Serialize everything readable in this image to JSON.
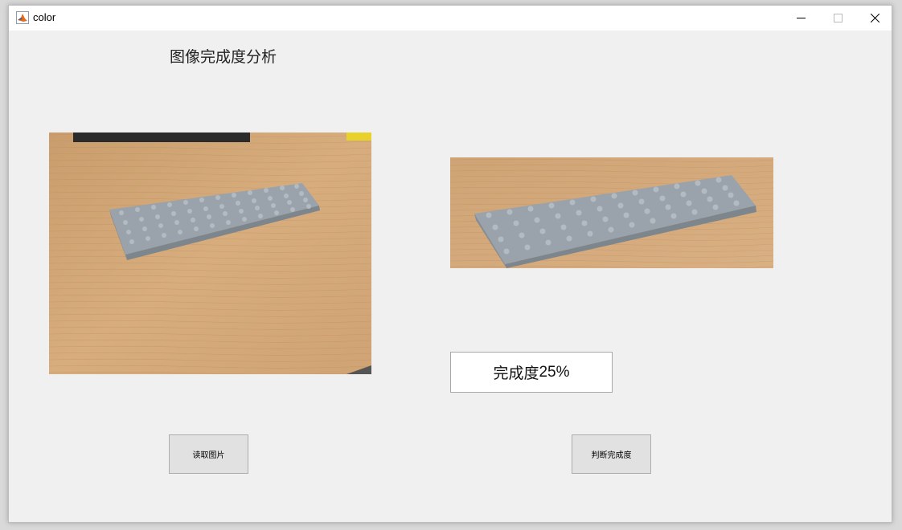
{
  "window": {
    "title": "color",
    "app_icon": "matlab-icon"
  },
  "controls": {
    "minimize": "minimize-icon",
    "maximize": "maximize-icon",
    "close": "close-icon"
  },
  "main": {
    "heading": "图像完成度分析",
    "result_label": "完成度",
    "result_value": "25%",
    "buttons": {
      "read_image": "读取图片",
      "judge": "判断完成度"
    }
  },
  "colors": {
    "button_bg": "#e1e1e1",
    "panel_bg": "#f0f0f0",
    "wood": "#d4a878",
    "lego_plate": "#9aa3ab"
  }
}
